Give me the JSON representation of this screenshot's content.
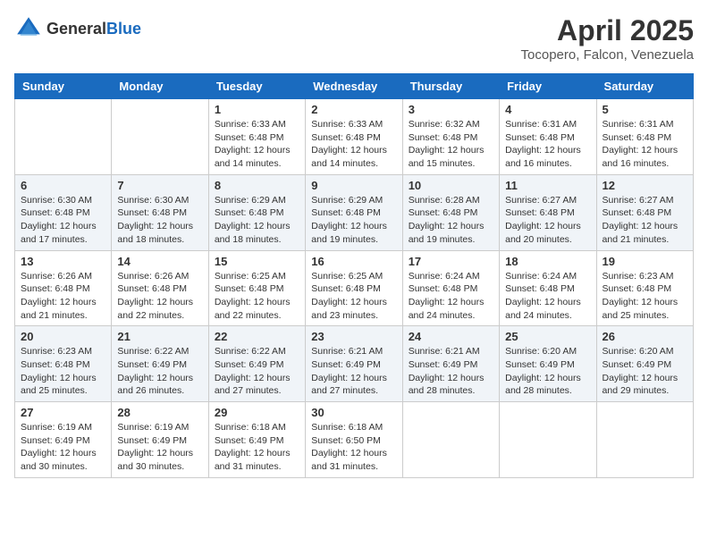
{
  "logo": {
    "general": "General",
    "blue": "Blue"
  },
  "header": {
    "title": "April 2025",
    "subtitle": "Tocopero, Falcon, Venezuela"
  },
  "days_of_week": [
    "Sunday",
    "Monday",
    "Tuesday",
    "Wednesday",
    "Thursday",
    "Friday",
    "Saturday"
  ],
  "weeks": [
    [
      {
        "day": "",
        "info": ""
      },
      {
        "day": "",
        "info": ""
      },
      {
        "day": "1",
        "sunrise": "6:33 AM",
        "sunset": "6:48 PM",
        "daylight": "12 hours and 14 minutes."
      },
      {
        "day": "2",
        "sunrise": "6:33 AM",
        "sunset": "6:48 PM",
        "daylight": "12 hours and 14 minutes."
      },
      {
        "day": "3",
        "sunrise": "6:32 AM",
        "sunset": "6:48 PM",
        "daylight": "12 hours and 15 minutes."
      },
      {
        "day": "4",
        "sunrise": "6:31 AM",
        "sunset": "6:48 PM",
        "daylight": "12 hours and 16 minutes."
      },
      {
        "day": "5",
        "sunrise": "6:31 AM",
        "sunset": "6:48 PM",
        "daylight": "12 hours and 16 minutes."
      }
    ],
    [
      {
        "day": "6",
        "sunrise": "6:30 AM",
        "sunset": "6:48 PM",
        "daylight": "12 hours and 17 minutes."
      },
      {
        "day": "7",
        "sunrise": "6:30 AM",
        "sunset": "6:48 PM",
        "daylight": "12 hours and 18 minutes."
      },
      {
        "day": "8",
        "sunrise": "6:29 AM",
        "sunset": "6:48 PM",
        "daylight": "12 hours and 18 minutes."
      },
      {
        "day": "9",
        "sunrise": "6:29 AM",
        "sunset": "6:48 PM",
        "daylight": "12 hours and 19 minutes."
      },
      {
        "day": "10",
        "sunrise": "6:28 AM",
        "sunset": "6:48 PM",
        "daylight": "12 hours and 19 minutes."
      },
      {
        "day": "11",
        "sunrise": "6:27 AM",
        "sunset": "6:48 PM",
        "daylight": "12 hours and 20 minutes."
      },
      {
        "day": "12",
        "sunrise": "6:27 AM",
        "sunset": "6:48 PM",
        "daylight": "12 hours and 21 minutes."
      }
    ],
    [
      {
        "day": "13",
        "sunrise": "6:26 AM",
        "sunset": "6:48 PM",
        "daylight": "12 hours and 21 minutes."
      },
      {
        "day": "14",
        "sunrise": "6:26 AM",
        "sunset": "6:48 PM",
        "daylight": "12 hours and 22 minutes."
      },
      {
        "day": "15",
        "sunrise": "6:25 AM",
        "sunset": "6:48 PM",
        "daylight": "12 hours and 22 minutes."
      },
      {
        "day": "16",
        "sunrise": "6:25 AM",
        "sunset": "6:48 PM",
        "daylight": "12 hours and 23 minutes."
      },
      {
        "day": "17",
        "sunrise": "6:24 AM",
        "sunset": "6:48 PM",
        "daylight": "12 hours and 24 minutes."
      },
      {
        "day": "18",
        "sunrise": "6:24 AM",
        "sunset": "6:48 PM",
        "daylight": "12 hours and 24 minutes."
      },
      {
        "day": "19",
        "sunrise": "6:23 AM",
        "sunset": "6:48 PM",
        "daylight": "12 hours and 25 minutes."
      }
    ],
    [
      {
        "day": "20",
        "sunrise": "6:23 AM",
        "sunset": "6:48 PM",
        "daylight": "12 hours and 25 minutes."
      },
      {
        "day": "21",
        "sunrise": "6:22 AM",
        "sunset": "6:49 PM",
        "daylight": "12 hours and 26 minutes."
      },
      {
        "day": "22",
        "sunrise": "6:22 AM",
        "sunset": "6:49 PM",
        "daylight": "12 hours and 27 minutes."
      },
      {
        "day": "23",
        "sunrise": "6:21 AM",
        "sunset": "6:49 PM",
        "daylight": "12 hours and 27 minutes."
      },
      {
        "day": "24",
        "sunrise": "6:21 AM",
        "sunset": "6:49 PM",
        "daylight": "12 hours and 28 minutes."
      },
      {
        "day": "25",
        "sunrise": "6:20 AM",
        "sunset": "6:49 PM",
        "daylight": "12 hours and 28 minutes."
      },
      {
        "day": "26",
        "sunrise": "6:20 AM",
        "sunset": "6:49 PM",
        "daylight": "12 hours and 29 minutes."
      }
    ],
    [
      {
        "day": "27",
        "sunrise": "6:19 AM",
        "sunset": "6:49 PM",
        "daylight": "12 hours and 30 minutes."
      },
      {
        "day": "28",
        "sunrise": "6:19 AM",
        "sunset": "6:49 PM",
        "daylight": "12 hours and 30 minutes."
      },
      {
        "day": "29",
        "sunrise": "6:18 AM",
        "sunset": "6:49 PM",
        "daylight": "12 hours and 31 minutes."
      },
      {
        "day": "30",
        "sunrise": "6:18 AM",
        "sunset": "6:50 PM",
        "daylight": "12 hours and 31 minutes."
      },
      {
        "day": "",
        "info": ""
      },
      {
        "day": "",
        "info": ""
      },
      {
        "day": "",
        "info": ""
      }
    ]
  ],
  "labels": {
    "sunrise": "Sunrise:",
    "sunset": "Sunset:",
    "daylight": "Daylight: "
  }
}
